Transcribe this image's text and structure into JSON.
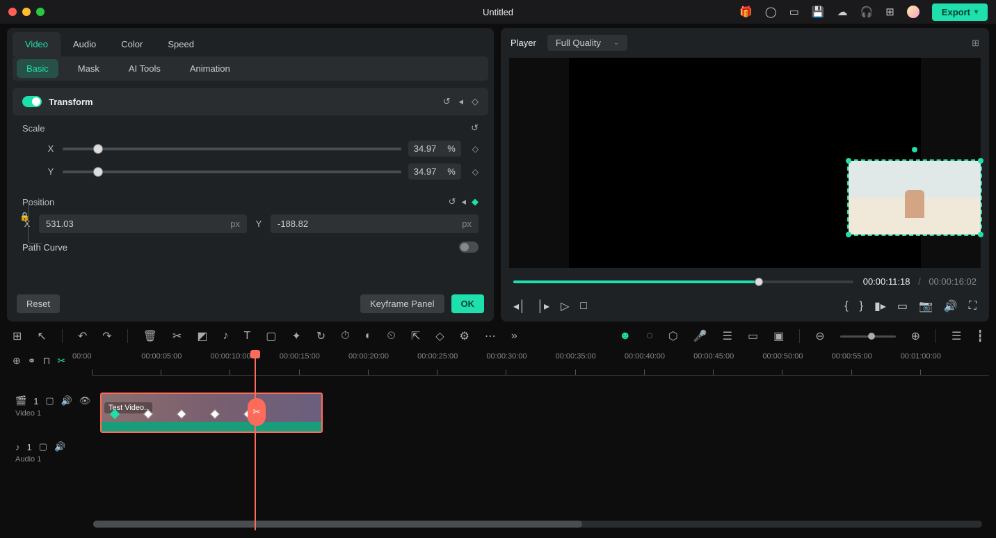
{
  "titlebar": {
    "title": "Untitled",
    "export_label": "Export"
  },
  "inspector": {
    "tabs": [
      "Video",
      "Audio",
      "Color",
      "Speed"
    ],
    "active_tab": 0,
    "subtabs": [
      "Basic",
      "Mask",
      "AI Tools",
      "Animation"
    ],
    "active_subtab": 0,
    "transform": {
      "label": "Transform",
      "enabled": true,
      "scale": {
        "label": "Scale",
        "x_label": "X",
        "y_label": "Y",
        "x_value": "34.97",
        "y_value": "34.97",
        "unit": "%",
        "linked": true
      },
      "position": {
        "label": "Position",
        "x_label": "X",
        "y_label": "Y",
        "x_value": "531.03",
        "y_value": "-188.82",
        "unit": "px",
        "keyframe_active": true
      },
      "path_curve": {
        "label": "Path Curve",
        "enabled": false
      }
    },
    "footer": {
      "reset": "Reset",
      "keyframe_panel": "Keyframe Panel",
      "ok": "OK"
    }
  },
  "player": {
    "label": "Player",
    "quality_options": [
      "Full Quality"
    ],
    "quality_selected": "Full Quality",
    "current_time": "00:00:11:18",
    "duration": "00:00:16:02"
  },
  "timeline": {
    "ruler_marks": [
      "00:00",
      "00:00:05:00",
      "00:00:10:00",
      "00:00:15:00",
      "00:00:20:00",
      "00:00:25:00",
      "00:00:30:00",
      "00:00:35:00",
      "00:00:40:00",
      "00:00:45:00",
      "00:00:50:00",
      "00:00:55:00",
      "00:01:00:00"
    ],
    "tracks": {
      "video1": {
        "name": "Video 1",
        "index": "1"
      },
      "audio1": {
        "name": "Audio 1",
        "index": "1"
      }
    },
    "clip": {
      "label": "Test Video.."
    }
  }
}
